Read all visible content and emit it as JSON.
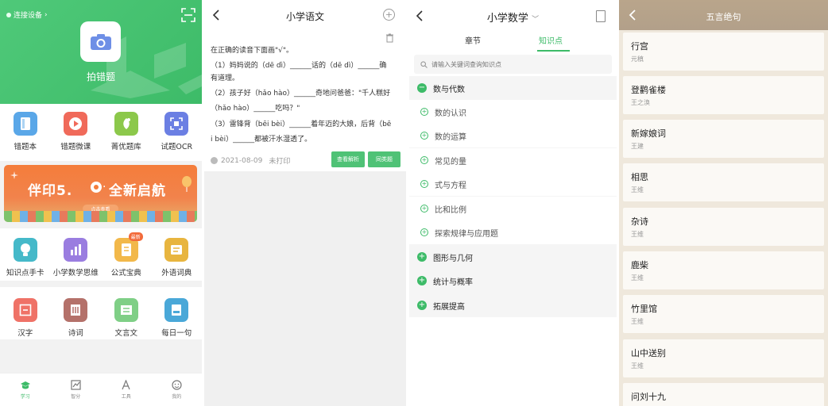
{
  "panel1": {
    "device_link": "连接设备",
    "camera_label": "拍错题",
    "row1": [
      {
        "label": "错题本",
        "icon": "notebook-icon",
        "color": "#5aa7e8"
      },
      {
        "label": "错题微课",
        "icon": "play-icon",
        "color": "#f06a5a"
      },
      {
        "label": "菁优题库",
        "icon": "library-icon",
        "color": "#8cc84b"
      },
      {
        "label": "试题OCR",
        "icon": "ocr-icon",
        "color": "#6b7fe3"
      }
    ],
    "banner": {
      "text_left": "伴印5.",
      "text_right": "全新启航",
      "pill": "点击查看"
    },
    "row2": [
      {
        "label": "知识点手卡",
        "icon": "bulb-icon",
        "color": "#45b9c9",
        "badge": ""
      },
      {
        "label": "小学数学思维",
        "icon": "chart-icon",
        "color": "#9a7de0",
        "badge": ""
      },
      {
        "label": "公式宝典",
        "icon": "formula-icon",
        "color": "#f2b84a",
        "badge": "最新"
      },
      {
        "label": "外语词典",
        "icon": "dictionary-icon",
        "color": "#e8b53f",
        "badge": ""
      }
    ],
    "row3": [
      {
        "label": "汉字",
        "icon": "hanzi-icon",
        "color": "#ef7267"
      },
      {
        "label": "诗词",
        "icon": "poetry-icon",
        "color": "#b4716a"
      },
      {
        "label": "文言文",
        "icon": "classical-icon",
        "color": "#7fcf86"
      },
      {
        "label": "每日一句",
        "icon": "daily-icon",
        "color": "#4aa8d8"
      }
    ],
    "tabbar": [
      {
        "label": "学习",
        "icon": "study-icon",
        "active": true
      },
      {
        "label": "智分",
        "icon": "score-icon",
        "active": false
      },
      {
        "label": "工具",
        "icon": "tools-icon",
        "active": false
      },
      {
        "label": "我的",
        "icon": "profile-icon",
        "active": false
      }
    ]
  },
  "panel2": {
    "title": "小学语文",
    "question_lines": [
      "在正确的读音下面画\"√\"。",
      "（1）妈妈说的（dē dì）______话的（dē dì）______确",
      "有道理。",
      "（2）孩子好（hǎo hào）______奇地问爸爸：\"千人糕好",
      "（hǎo hào）______吃吗？\"",
      "（3）雷锋背（bēi bèi）______着年迈的大娘，后背（bē",
      "i bèi）______都被汗水湿透了。"
    ],
    "date": "2021-08-09",
    "print_status": "未打印",
    "btn_answer": "查看解析",
    "btn_similar": "同类题"
  },
  "panel3": {
    "title": "小学数学",
    "tab_chapter": "章节",
    "tab_knowledge": "知识点",
    "search_placeholder": "请输入关键词查询知识点",
    "tree": [
      {
        "label": "数与代数",
        "level": "top",
        "expanded": true
      },
      {
        "label": "数的认识",
        "level": "sub"
      },
      {
        "label": "数的运算",
        "level": "sub"
      },
      {
        "label": "常见的量",
        "level": "sub"
      },
      {
        "label": "式与方程",
        "level": "sub"
      },
      {
        "label": "比和比例",
        "level": "sub"
      },
      {
        "label": "探索规律与应用题",
        "level": "sub"
      },
      {
        "label": "图形与几何",
        "level": "top",
        "expanded": false
      },
      {
        "label": "统计与概率",
        "level": "top",
        "expanded": false
      },
      {
        "label": "拓展提高",
        "level": "top",
        "expanded": false
      }
    ]
  },
  "panel4": {
    "title": "五言绝句",
    "poems": [
      {
        "title": "行宫",
        "author": "元稹"
      },
      {
        "title": "登鹳雀楼",
        "author": "王之涣"
      },
      {
        "title": "新嫁娘词",
        "author": "王建"
      },
      {
        "title": "相思",
        "author": "王维"
      },
      {
        "title": "杂诗",
        "author": "王维"
      },
      {
        "title": "鹿柴",
        "author": "王维"
      },
      {
        "title": "竹里馆",
        "author": "王维"
      },
      {
        "title": "山中送别",
        "author": "王维"
      },
      {
        "title": "问刘十九",
        "author": ""
      }
    ]
  }
}
